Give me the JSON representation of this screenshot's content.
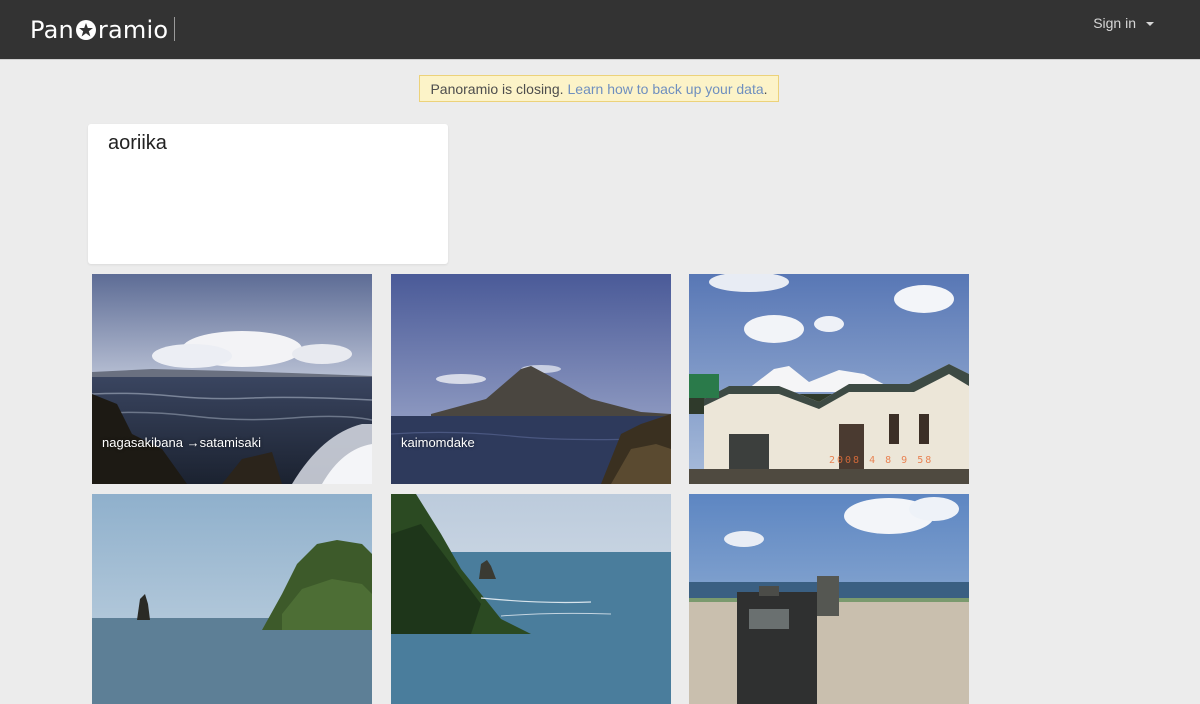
{
  "header": {
    "brand_prefix": "Pan",
    "brand_suffix": "ramio",
    "signin_label": "Sign in"
  },
  "notice": {
    "text": "Panoramio is closing.",
    "link_text": "Learn how to back up your data",
    "suffix": "."
  },
  "profile": {
    "username": "aoriika"
  },
  "photos": [
    {
      "caption": "nagasakibana →satamisaki"
    },
    {
      "caption": "kaimomdake"
    },
    {
      "caption": "",
      "stamp": "2008 4  8  9 58"
    },
    {
      "caption": ""
    },
    {
      "caption": ""
    },
    {
      "caption": ""
    }
  ],
  "colors": {
    "topbar": "#333333",
    "page_bg": "#ececec",
    "notice_bg": "#fcf3c8",
    "link": "#6f8fbf"
  }
}
